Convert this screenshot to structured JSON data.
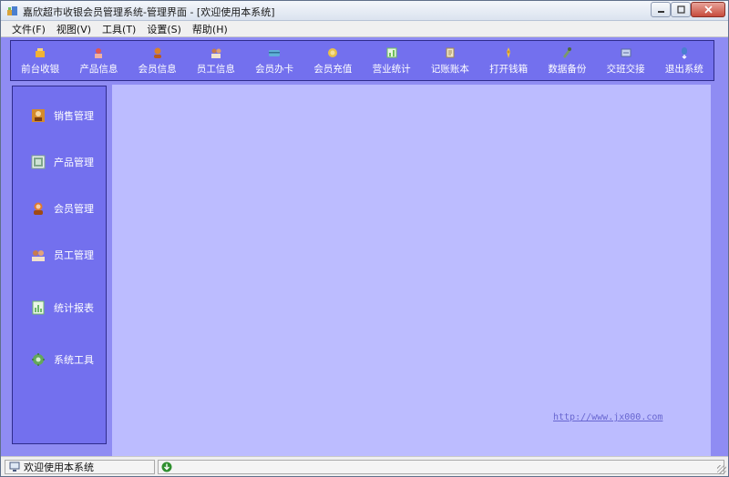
{
  "window": {
    "title": "嘉欣超市收银会员管理系统-管理界面 - [欢迎使用本系统]",
    "icon": "app-icon"
  },
  "menu": [
    {
      "label": "文件(F)"
    },
    {
      "label": "视图(V)"
    },
    {
      "label": "工具(T)"
    },
    {
      "label": "设置(S)"
    },
    {
      "label": "帮助(H)"
    }
  ],
  "toolbar": [
    {
      "label": "前台收银",
      "icon": "cashier-icon",
      "color": "#f2b233"
    },
    {
      "label": "产品信息",
      "icon": "product-icon",
      "color": "#e0574f"
    },
    {
      "label": "会员信息",
      "icon": "member-icon",
      "color": "#d9822b"
    },
    {
      "label": "员工信息",
      "icon": "staff-icon",
      "color": "#c77b4a"
    },
    {
      "label": "会员办卡",
      "icon": "card-icon",
      "color": "#5fb0d8"
    },
    {
      "label": "会员充值",
      "icon": "recharge-icon",
      "color": "#e8c04a"
    },
    {
      "label": "营业统计",
      "icon": "stats-icon",
      "color": "#6fbf5a"
    },
    {
      "label": "记账账本",
      "icon": "ledger-icon",
      "color": "#f0e6c8"
    },
    {
      "label": "打开钱箱",
      "icon": "cashbox-icon",
      "color": "#f5c542"
    },
    {
      "label": "数据备份",
      "icon": "backup-icon",
      "color": "#7a9a6a"
    },
    {
      "label": "交班交接",
      "icon": "handover-icon",
      "color": "#c8d4f0"
    },
    {
      "label": "退出系统",
      "icon": "exit-icon",
      "color": "#4a7fd0"
    }
  ],
  "sidebar": [
    {
      "label": "销售管理",
      "icon": "sales-icon",
      "color": "#d48a2c"
    },
    {
      "label": "产品管理",
      "icon": "product-mgmt-icon",
      "color": "#7fa68a"
    },
    {
      "label": "会员管理",
      "icon": "member-mgmt-icon",
      "color": "#e07a2f"
    },
    {
      "label": "员工管理",
      "icon": "staff-mgmt-icon",
      "color": "#c87b4e"
    },
    {
      "label": "统计报表",
      "icon": "report-icon",
      "color": "#6fb96a"
    },
    {
      "label": "系统工具",
      "icon": "tools-icon",
      "color": "#63a85a"
    }
  ],
  "main": {
    "link": "http://www.jx000.com"
  },
  "status": {
    "pane1_text": "欢迎使用本系统",
    "pane1_icon": "computer-icon",
    "pane2_icon": "arrow-down-icon"
  },
  "colors": {
    "toolbar_bg": "#7370ee",
    "band_bg": "#8f8cf3",
    "main_bg": "#bcbcff"
  }
}
